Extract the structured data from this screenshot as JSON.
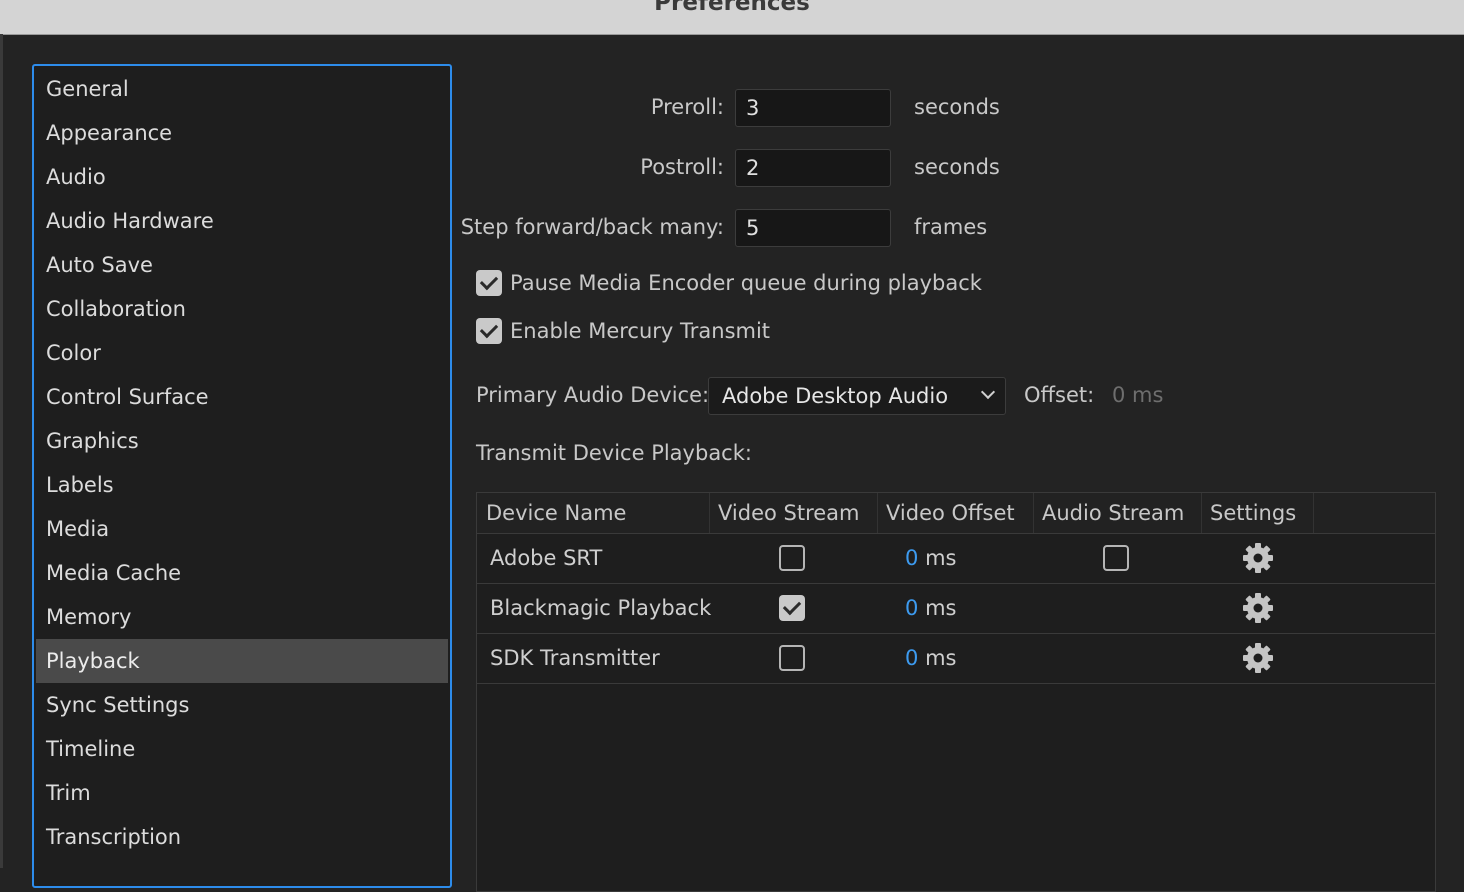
{
  "window": {
    "title": "Preferences"
  },
  "sidebar": {
    "items": [
      {
        "label": "General",
        "selected": false
      },
      {
        "label": "Appearance",
        "selected": false
      },
      {
        "label": "Audio",
        "selected": false
      },
      {
        "label": "Audio Hardware",
        "selected": false
      },
      {
        "label": "Auto Save",
        "selected": false
      },
      {
        "label": "Collaboration",
        "selected": false
      },
      {
        "label": "Color",
        "selected": false
      },
      {
        "label": "Control Surface",
        "selected": false
      },
      {
        "label": "Graphics",
        "selected": false
      },
      {
        "label": "Labels",
        "selected": false
      },
      {
        "label": "Media",
        "selected": false
      },
      {
        "label": "Media Cache",
        "selected": false
      },
      {
        "label": "Memory",
        "selected": false
      },
      {
        "label": "Playback",
        "selected": true
      },
      {
        "label": "Sync Settings",
        "selected": false
      },
      {
        "label": "Timeline",
        "selected": false
      },
      {
        "label": "Trim",
        "selected": false
      },
      {
        "label": "Transcription",
        "selected": false
      }
    ]
  },
  "playback": {
    "preroll": {
      "label": "Preroll:",
      "value": "3",
      "unit": "seconds"
    },
    "postroll": {
      "label": "Postroll:",
      "value": "2",
      "unit": "seconds"
    },
    "step": {
      "label": "Step forward/back many:",
      "value": "5",
      "unit": "frames"
    },
    "pause_encoder": {
      "label": "Pause Media Encoder queue during playback",
      "checked": true
    },
    "mercury": {
      "label": "Enable Mercury Transmit",
      "checked": true
    },
    "audio_device": {
      "label": "Primary Audio Device:",
      "value": "Adobe Desktop Audio"
    },
    "offset": {
      "label": "Offset:",
      "value": "0 ms"
    },
    "transmit_label": "Transmit Device Playback:"
  },
  "transmit_table": {
    "headers": [
      "Device Name",
      "Video Stream",
      "Video Offset",
      "Audio Stream",
      "Settings"
    ],
    "rows": [
      {
        "name": "Adobe SRT",
        "video_stream": false,
        "offset_value": "0",
        "offset_unit": "ms",
        "audio_stream": false,
        "has_audio_stream": true,
        "settings_icon": "gear-icon"
      },
      {
        "name": "Blackmagic Playback",
        "video_stream": true,
        "offset_value": "0",
        "offset_unit": "ms",
        "has_audio_stream": false,
        "settings_icon": "gear-icon"
      },
      {
        "name": "SDK Transmitter",
        "video_stream": false,
        "offset_value": "0",
        "offset_unit": "ms",
        "has_audio_stream": false,
        "settings_icon": "gear-icon"
      }
    ]
  },
  "colors": {
    "accent": "#2d8ceb",
    "offset_value": "#3d9bf0",
    "selected_row": "#4a4a4a"
  }
}
